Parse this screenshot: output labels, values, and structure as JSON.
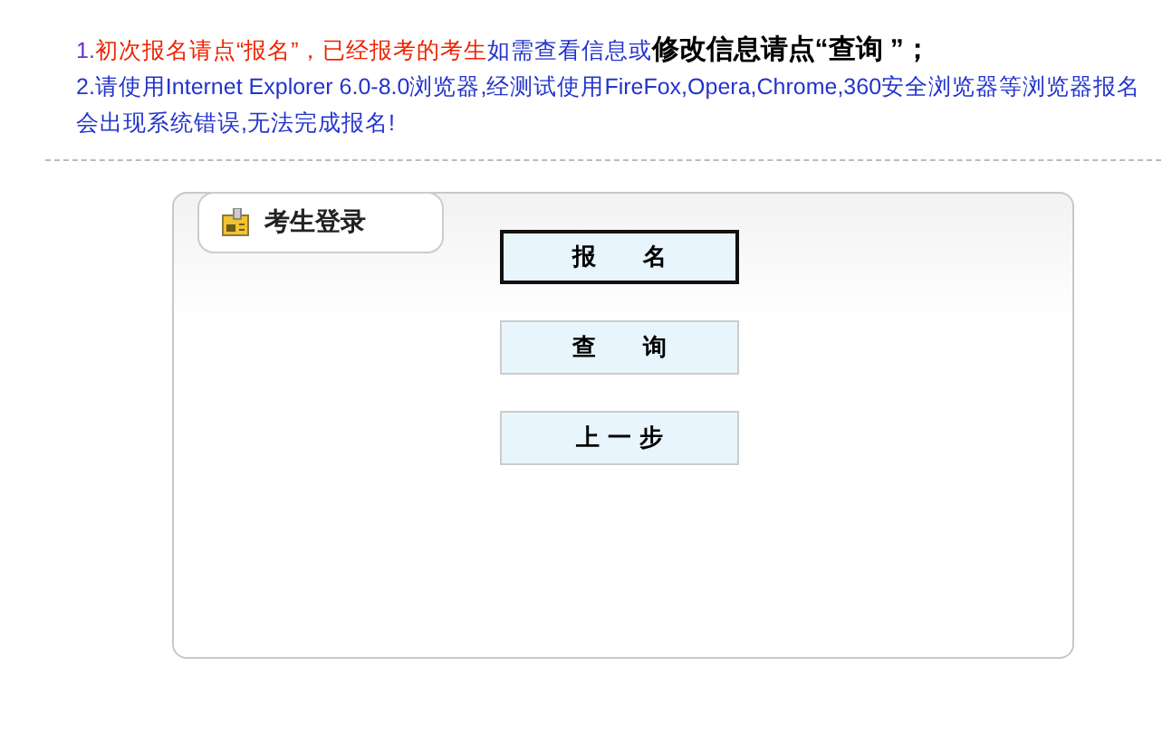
{
  "notice": [
    {
      "segments": [
        {
          "kind": "number",
          "text": "1."
        },
        {
          "kind": "warning",
          "text": "初次报名请点“报名”，已经报考的考生"
        },
        {
          "kind": "info",
          "text": "如需查看信息或"
        },
        {
          "kind": "emphasis",
          "text": "修改信息请点“查询 ”；"
        }
      ]
    },
    {
      "segments": [
        {
          "kind": "info",
          "text": "2.请使用Internet Explorer 6.0-8.0浏览器,经测试使用FireFox,Opera,Chrome,360安全浏览器等浏览器报名会出现系统错误,无法完成报名!"
        }
      ]
    }
  ],
  "panel": {
    "title": "考生登录",
    "buttons": [
      {
        "label": "报　　名",
        "focused": true
      },
      {
        "label": "查　　询",
        "focused": false
      },
      {
        "label": "上 一 步",
        "focused": false
      }
    ]
  }
}
